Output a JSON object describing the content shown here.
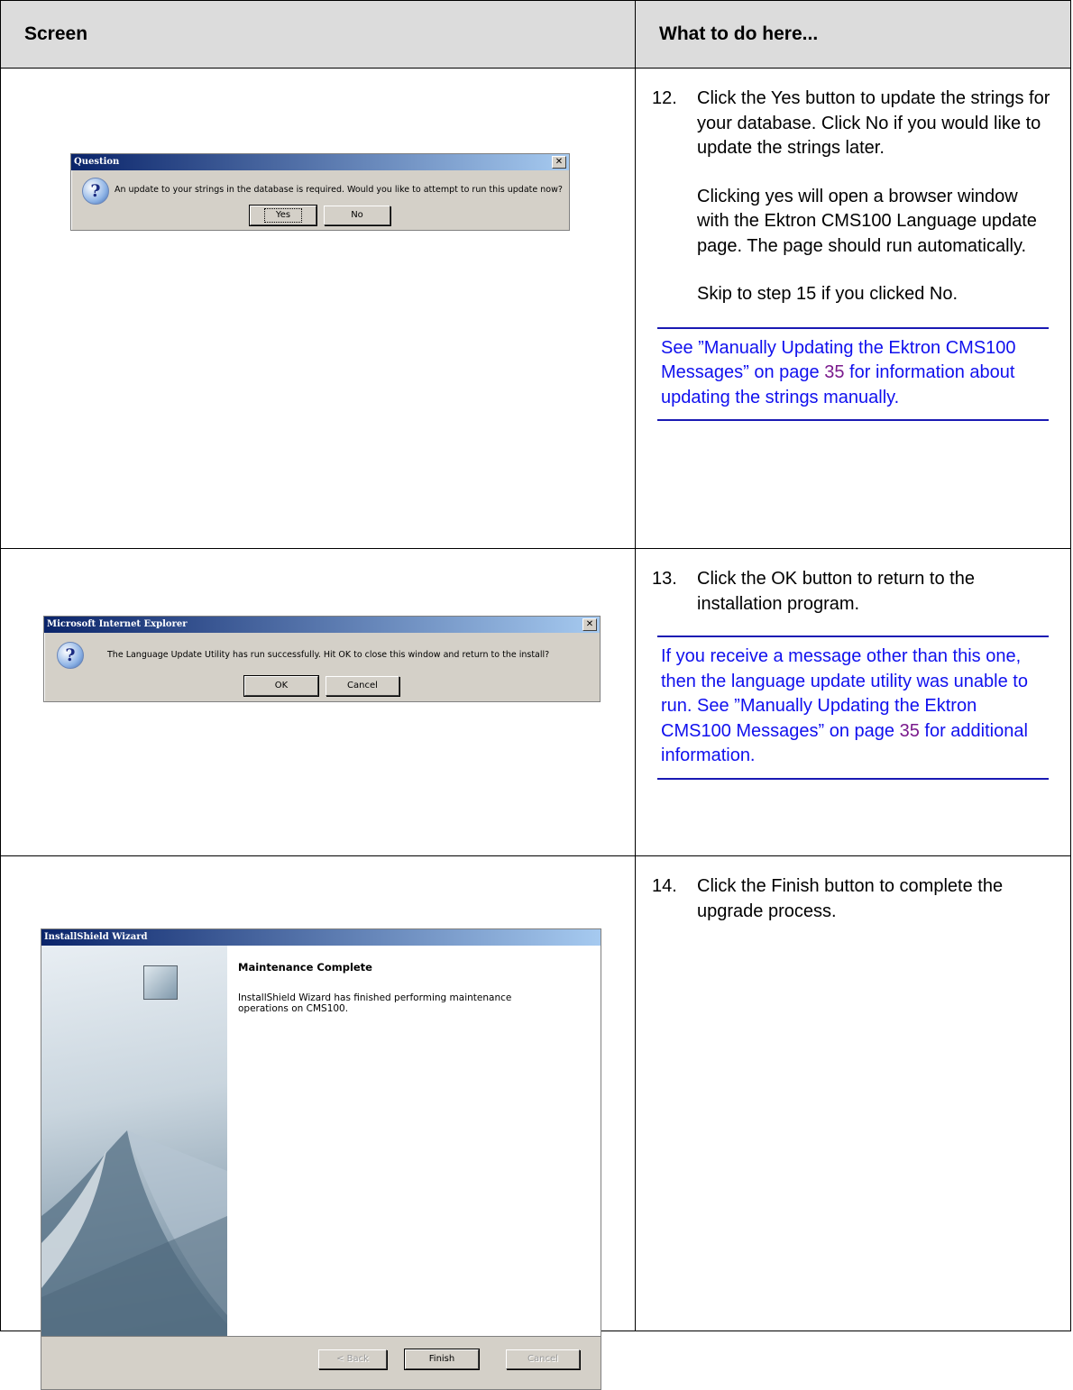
{
  "header": {
    "col1": "Screen",
    "col2": "What to do here..."
  },
  "step12": {
    "num": "12.",
    "p1": "Click the Yes button to update the strings for your database. Click No if you would like to update the strings later.",
    "p2": "Clicking yes will open a browser window with the Ektron CMS100 Language update page. The page should run automatically.",
    "p3": "Skip to step 15 if you clicked No.",
    "note_before": "See ”Manually Updating the Ektron CMS100 Messages” on page ",
    "note_page": "35",
    "note_after": " for information about updating the strings manually."
  },
  "step13": {
    "num": "13.",
    "p1": "Click the OK button to return to the installation program.",
    "note_before": "If you receive a message other than this one, then the language update utility was unable to run. See ”Manually Updating the Ektron CMS100 Messages” on page ",
    "note_page": "35",
    "note_after": " for additional information."
  },
  "step14": {
    "num": "14.",
    "p1": "Click the Finish button to complete the upgrade process."
  },
  "dialog1": {
    "title": "Question",
    "message": "An update to your strings in the database is required. Would you like to attempt to run this update now?",
    "yes": "Yes",
    "no": "No",
    "close": "✕"
  },
  "dialog2": {
    "title": "Microsoft Internet Explorer",
    "message": "The Language Update Utility has run successfully. Hit OK to close this window and return to the install?",
    "ok": "OK",
    "cancel": "Cancel",
    "close": "✕"
  },
  "wizard": {
    "title": "InstallShield Wizard",
    "heading": "Maintenance Complete",
    "text": "InstallShield Wizard has finished performing maintenance operations on CMS100.",
    "back": "< Back",
    "finish": "Finish",
    "cancel": "Cancel"
  }
}
